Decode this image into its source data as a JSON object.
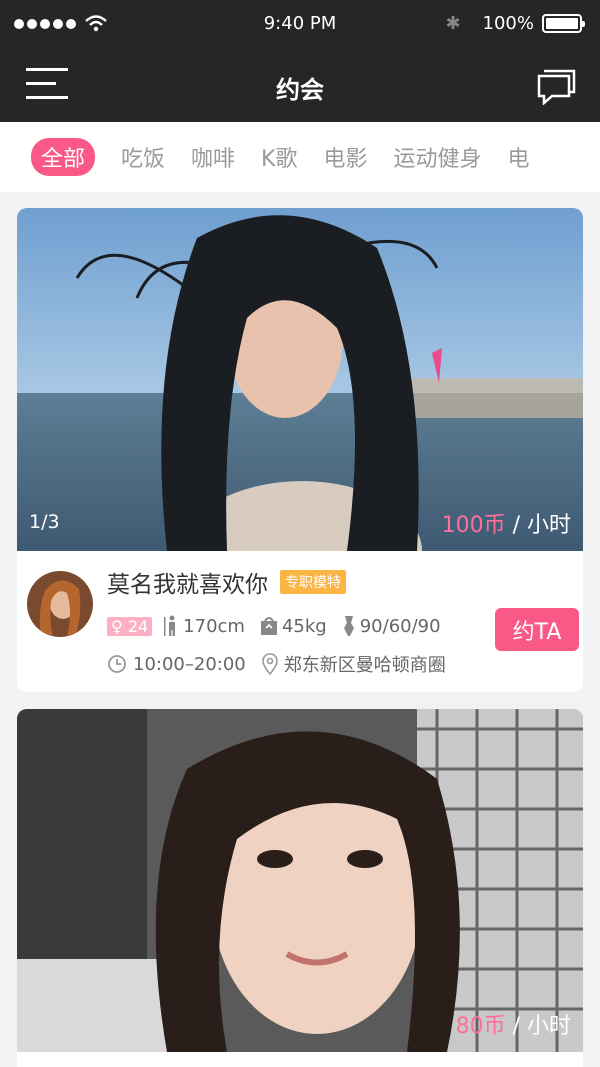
{
  "status_bar": {
    "time": "9:40 PM",
    "battery": "100%"
  },
  "header": {
    "title": "约会"
  },
  "tabs": [
    "全部",
    "吃饭",
    "咖啡",
    "K歌",
    "电影",
    "运动健身",
    "电"
  ],
  "active_tab": "全部",
  "cards": [
    {
      "counter": "1/3",
      "price_amount": "100币",
      "price_unit": " / 小时",
      "name": "莫名我就喜欢你",
      "badge": "专职模特",
      "age": "24",
      "height": "170cm",
      "weight": "45kg",
      "measurements": "90/60/90",
      "hours": "10:00–20:00",
      "location": "郑东新区曼哈顿商圈",
      "action_label": "约TA"
    },
    {
      "price_amount": "80币",
      "price_unit": " / 小时"
    }
  ],
  "colors": {
    "accent": "#fa5988",
    "bar": "#262626",
    "badge_orange": "#fbb545"
  }
}
